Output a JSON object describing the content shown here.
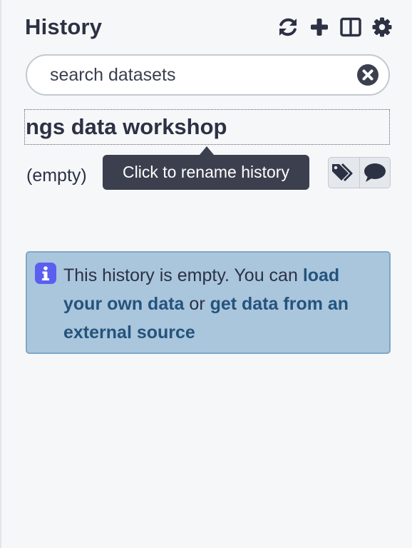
{
  "header": {
    "title": "History",
    "icons": [
      "refresh-icon",
      "plus-icon",
      "columns-icon",
      "gear-icon"
    ]
  },
  "search": {
    "placeholder": "search datasets",
    "value": ""
  },
  "history": {
    "name": "ngs data workshop",
    "size": "(empty)",
    "tooltip": "Click to rename history"
  },
  "alert": {
    "text_before": "This history is empty. You can ",
    "link_load": "load your own data",
    "text_middle": " or ",
    "link_external": "get data from an external source"
  },
  "colors": {
    "text": "#2c3143",
    "alert_bg": "#a9c6dd",
    "alert_link": "#25537b",
    "info_icon": "#5a5ff0",
    "tooltip_bg": "#3c404e"
  }
}
